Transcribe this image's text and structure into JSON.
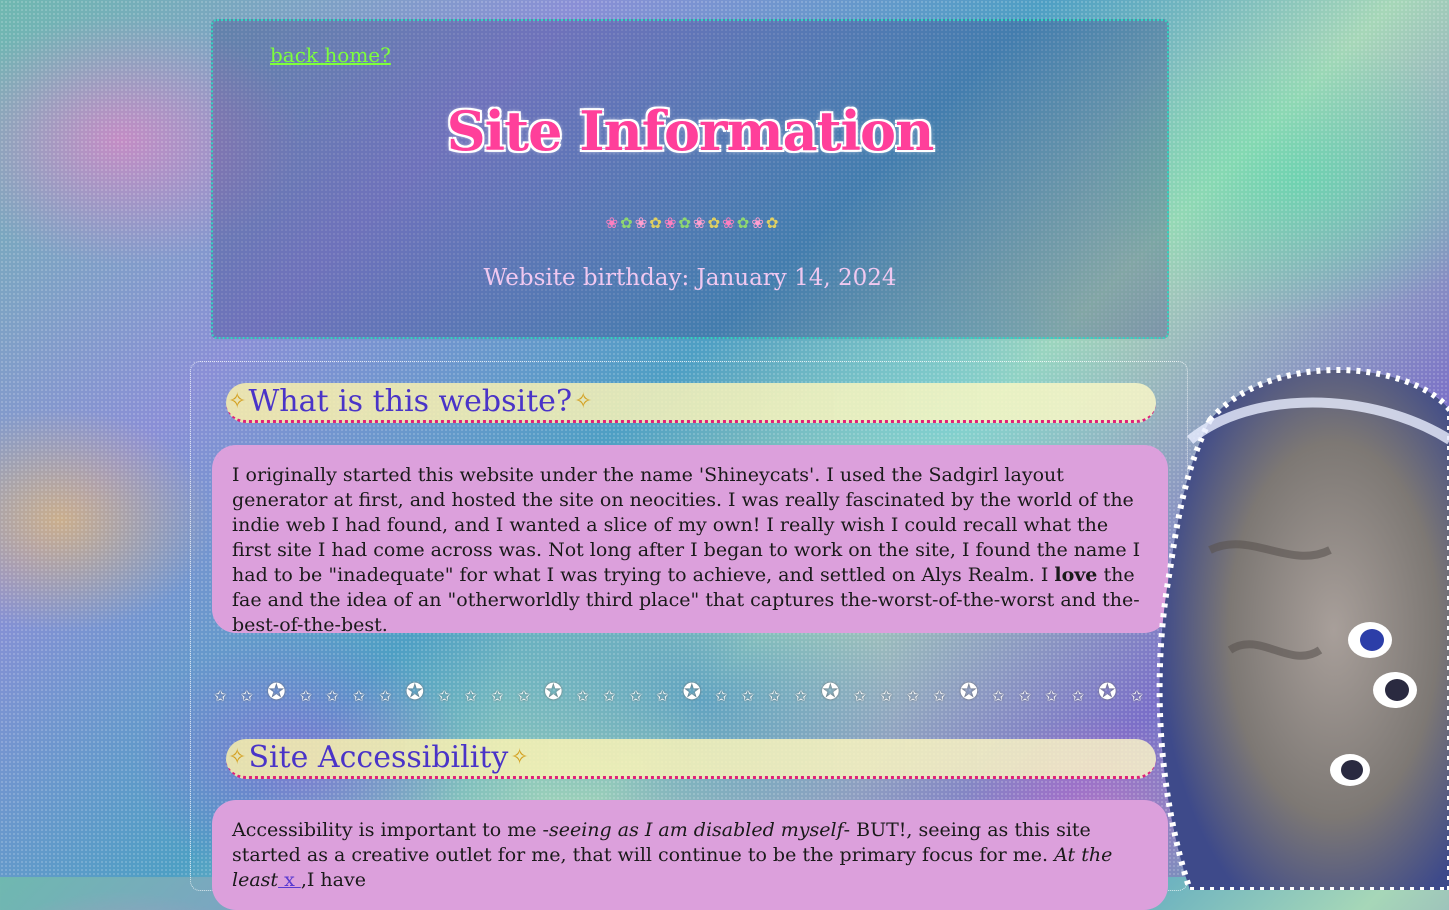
{
  "nav": {
    "back_link": "back home?"
  },
  "header": {
    "title": "Site Information",
    "birthday": "Website birthday: January 14, 2024"
  },
  "sections": [
    {
      "heading": "What is this website?",
      "body_parts": {
        "p1": "I originally started this website under the name 'Shineycats'. I used the Sadgirl layout generator at first, and hosted the site on neocities. I was really fascinated by the world of the indie web I had found, and I wanted a slice of my own! I really wish I could recall what the first site I had come across was. Not long after I began to work on the site, I found the name I had to be \"inadequate\" for what I was trying to achieve, and settled on Alys Realm. I ",
        "bold": "love",
        "p2": " the fae and the idea of an \"otherworldly third place\" that captures the-worst-of-the-worst and the-best-of-the-best."
      }
    },
    {
      "heading": "Site Accessibility",
      "body_parts": {
        "p1": "Accessibility is important to me -",
        "italic1": "seeing as I am disabled myself",
        "p2": "- BUT!, seeing as this site started as a creative outlet for me, that will continue to be the primary focus for me. ",
        "italic2": "At the least",
        "link": " x ",
        "p3": ",I have"
      }
    }
  ],
  "colors": {
    "title": "#ff3f9a",
    "heading_text": "#4a34c8",
    "text_box_bg": "#dca0dc",
    "back_link": "#7dff3c",
    "panel_border": "#32d6c0"
  },
  "icons": {
    "sparkle": "sparkle-icon",
    "flower": "flower-icon",
    "star": "star-icon",
    "jellyfish": "jellyfish-decoration"
  }
}
